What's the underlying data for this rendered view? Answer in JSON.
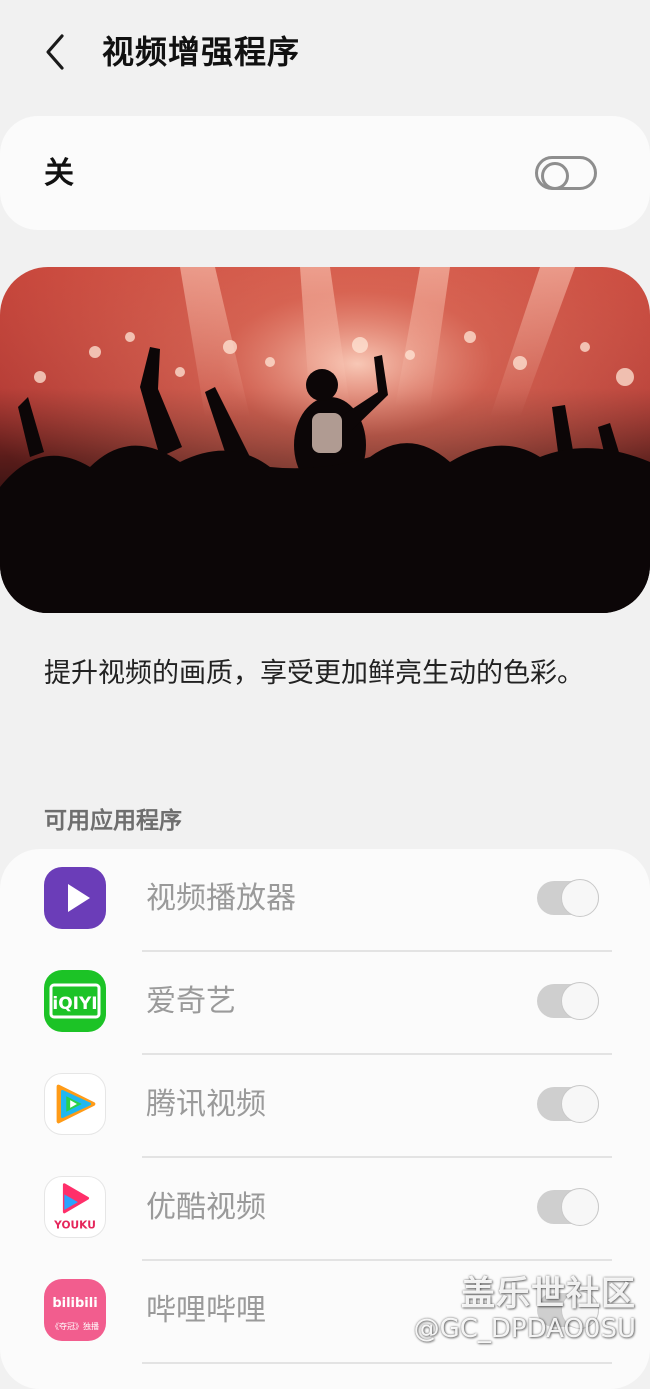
{
  "header": {
    "title": "视频增强程序",
    "back_icon": "back-arrow-icon"
  },
  "master_switch": {
    "label": "关",
    "state": "off"
  },
  "description": "提升视频的画质，享受更加鲜亮生动的色彩。",
  "section": {
    "title": "可用应用程序"
  },
  "apps": [
    {
      "name": "视频播放器",
      "icon": "video-player-icon",
      "state": "on",
      "enabled": false
    },
    {
      "name": "爱奇艺",
      "icon": "iqiyi-icon",
      "icon_text": "iQIYI",
      "state": "on",
      "enabled": false
    },
    {
      "name": "腾讯视频",
      "icon": "tencent-video-icon",
      "state": "on",
      "enabled": false
    },
    {
      "name": "优酷视频",
      "icon": "youku-icon",
      "icon_text": "YOUKU",
      "state": "on",
      "enabled": false
    },
    {
      "name": "哔哩哔哩",
      "icon": "bilibili-icon",
      "icon_text": "bilibili",
      "icon_subtext": "《夺冠》独播",
      "state": "on",
      "enabled": false
    }
  ],
  "watermark": {
    "line1": "盖乐世社区",
    "line2": "@GC_DPDAO0SU"
  },
  "colors": {
    "background": "#f1f1f1",
    "card": "#fbfbfb",
    "toggle_disabled": "#cfcfcf",
    "video_player": "#6b3db8",
    "iqiyi": "#1cc326",
    "bilibili": "#f25d8e"
  }
}
